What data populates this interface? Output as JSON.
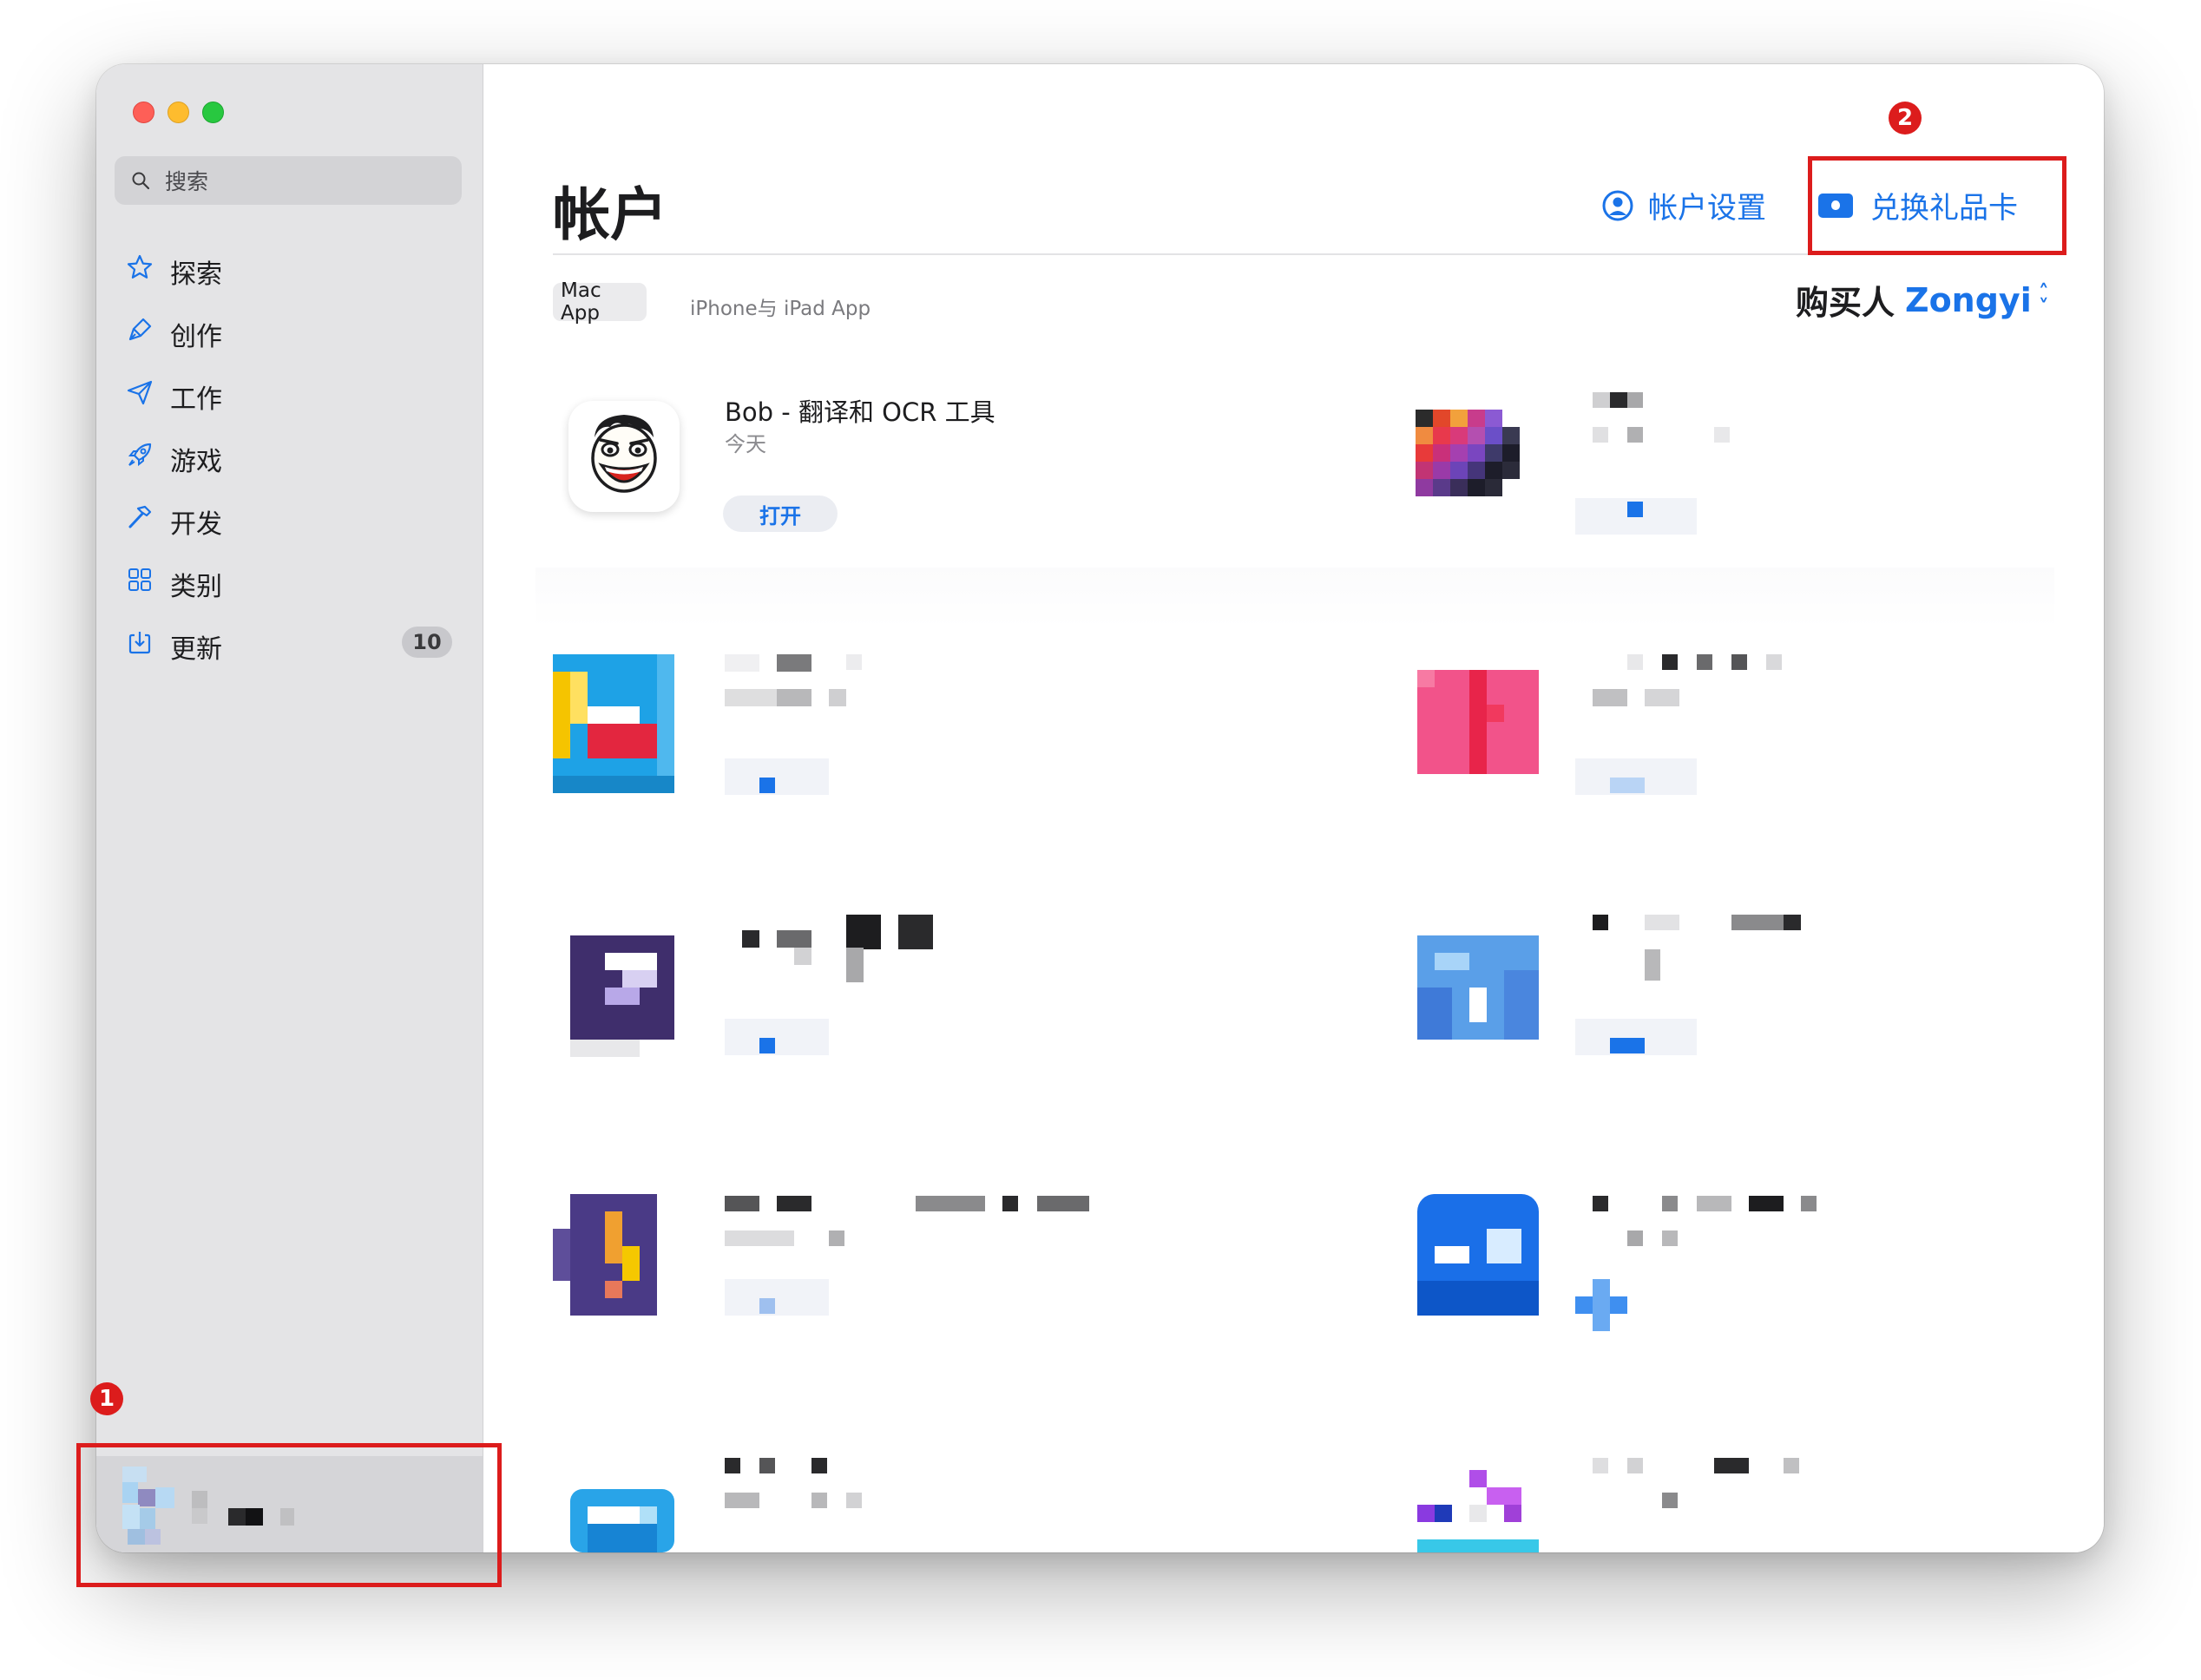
{
  "sidebar": {
    "search_placeholder": "搜索",
    "items": [
      {
        "label": "探索",
        "icon": "star-icon"
      },
      {
        "label": "创作",
        "icon": "brush-icon"
      },
      {
        "label": "工作",
        "icon": "paperplane-icon"
      },
      {
        "label": "游戏",
        "icon": "rocket-icon"
      },
      {
        "label": "开发",
        "icon": "hammer-icon"
      },
      {
        "label": "类别",
        "icon": "grid-icon"
      },
      {
        "label": "更新",
        "icon": "download-icon",
        "badge": "10"
      }
    ]
  },
  "main": {
    "title": "帐户",
    "account_settings_label": "帐户设置",
    "redeem_label": "兑换礼品卡",
    "tabs": [
      {
        "label": "Mac App",
        "selected": true
      },
      {
        "label": "iPhone与 iPad App",
        "selected": false
      }
    ],
    "buyer_prefix": "购买人",
    "buyer_name": "Zongyi",
    "apps": [
      {
        "name": "Bob - 翻译和 OCR 工具",
        "date": "今天",
        "action": "打开"
      }
    ]
  },
  "annotations": {
    "callout_1": "1",
    "callout_2": "2",
    "color": "#dc1c1c"
  },
  "colors": {
    "accent": "#1a73e8",
    "sidebar_bg": "#e4e4e6"
  }
}
